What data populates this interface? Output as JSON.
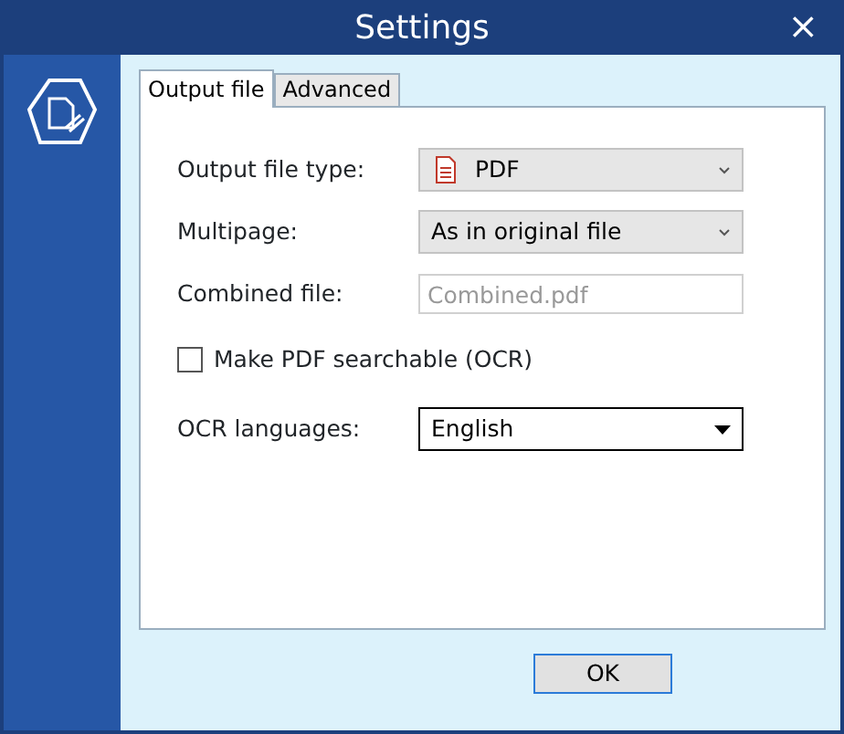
{
  "window": {
    "title": "Settings",
    "close": "×"
  },
  "tabs": [
    {
      "label": "Output file",
      "selected": true
    },
    {
      "label": "Advanced",
      "selected": false
    }
  ],
  "fields": [
    {
      "kind": "select",
      "label": "Output file type:",
      "value": "PDF",
      "file_icon": true
    },
    {
      "kind": "select",
      "label": "Multipage:",
      "value": "As in original file"
    },
    {
      "kind": "input",
      "label": "Combined file:",
      "placeholder": "Combined.pdf",
      "disabled": true
    },
    {
      "kind": "checkbox",
      "label": "Make PDF searchable (OCR)",
      "checked": false
    },
    {
      "kind": "dropdown",
      "label": "OCR languages:",
      "value": "English"
    }
  ],
  "buttons": [
    "OK"
  ]
}
